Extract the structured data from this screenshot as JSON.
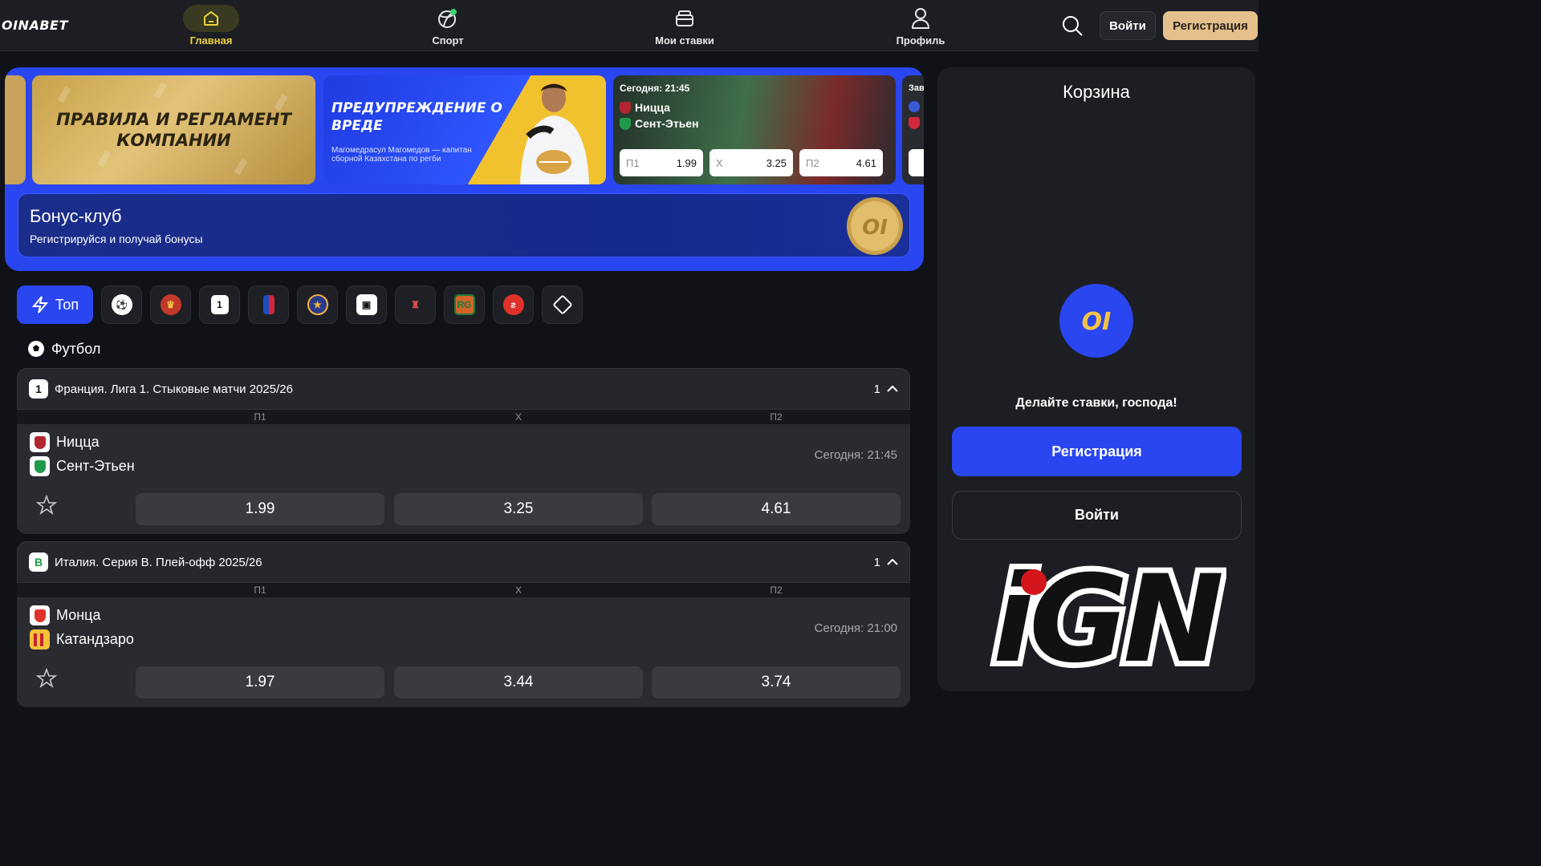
{
  "brand": {
    "logo_text": "OINABET"
  },
  "nav": {
    "items": [
      {
        "label": "Главная",
        "icon": "home-icon",
        "active": true
      },
      {
        "label": "Спорт",
        "icon": "sport-ball-icon",
        "active": false
      },
      {
        "label": "Мои ставки",
        "icon": "bets-icon",
        "active": false
      },
      {
        "label": "Профиль",
        "icon": "profile-icon",
        "active": false
      }
    ]
  },
  "header": {
    "login_label": "Войти",
    "register_label": "Регистрация",
    "search_icon": "search-icon"
  },
  "hero": {
    "rules_banner": "ПРАВИЛА И РЕГЛАМЕНТ КОМПАНИИ",
    "warning_banner": {
      "title": "ПРЕДУПРЕЖДЕНИЕ О ВРЕДЕ",
      "subtitle": "Магомедрасул Магомедов — капитан сборной Казахстана по регби"
    },
    "featured_match": {
      "time": "Сегодня: 21:45",
      "home": "Ницца",
      "away": "Сент-Этьен",
      "odds": [
        {
          "label": "П1",
          "value": "1.99"
        },
        {
          "label": "Х",
          "value": "3.25"
        },
        {
          "label": "П2",
          "value": "4.61"
        }
      ]
    },
    "peek_label": "Зав"
  },
  "bonus": {
    "title": "Бонус-клуб",
    "subtitle": "Регистрируйся и получай бонусы"
  },
  "filters": {
    "top_label": "Топ",
    "chips": [
      "soccer-ball-icon",
      "trophy-icon",
      "ligue1-icon",
      "nba-icon",
      "euroleague-icon",
      "nhl-icon",
      "knife-icon",
      "roland-garros-icon",
      "wimbledon-icon",
      "ufc-icon"
    ]
  },
  "section": {
    "title": "Футбол"
  },
  "leagues": [
    {
      "name": "Франция. Лига 1. Стыковые матчи 2025/26",
      "count": "1",
      "logo_text": "1",
      "cols": [
        "П1",
        "Х",
        "П2"
      ],
      "match": {
        "home": "Ницца",
        "away": "Сент-Этьен",
        "time": "Сегодня: 21:45",
        "odds": [
          "1.99",
          "3.25",
          "4.61"
        ]
      }
    },
    {
      "name": "Италия. Серия B. Плей-офф 2025/26",
      "count": "1",
      "logo_text": "B",
      "cols": [
        "П1",
        "Х",
        "П2"
      ],
      "match": {
        "home": "Монца",
        "away": "Катандзаро",
        "time": "Сегодня: 21:00",
        "odds": [
          "1.97",
          "3.44",
          "3.74"
        ]
      }
    }
  ],
  "cart": {
    "title": "Корзина",
    "message": "Делайте ставки, господа!",
    "register_label": "Регистрация",
    "login_label": "Войти"
  },
  "watermark": {
    "text": "iGN"
  },
  "colors": {
    "accent": "#2a46f0",
    "gold": "#e4c08d",
    "active_nav": "#e9d43a",
    "bg": "#111217"
  }
}
